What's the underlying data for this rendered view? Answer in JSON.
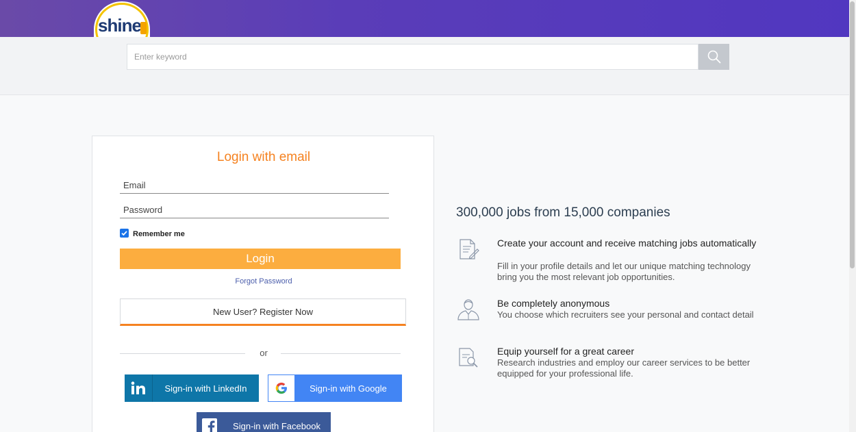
{
  "header": {
    "logo_text": "shine",
    "brand_color": "#5137c0",
    "logo_accent": "#f4c300"
  },
  "search": {
    "placeholder": "Enter keyword",
    "value": "",
    "button_icon": "search-icon"
  },
  "login": {
    "title": "Login with email",
    "email_placeholder": "Email",
    "password_placeholder": "Password",
    "remember_label": "Remember me",
    "remember_checked": true,
    "login_button": "Login",
    "forgot_password": "Forgot Password",
    "register": "New User? Register Now",
    "or_text": "or",
    "accent_color": "#f58220",
    "button_color": "#fcad3f"
  },
  "social": {
    "linkedin": "Sign-in with LinkedIn",
    "google": "Sign-in with Google",
    "facebook": "Sign-in with Facebook"
  },
  "promo": {
    "heading": "300,000 jobs from 15,000 companies",
    "features": [
      {
        "icon": "document-edit-icon",
        "title": "Create your account and receive matching jobs automatically",
        "description": "Fill in your profile details and let our unique matching technology bring you the most relevant job opportunities."
      },
      {
        "icon": "person-icon",
        "title": "Be completely anonymous",
        "description": "You choose which recruiters see your personal and contact detail"
      },
      {
        "icon": "document-search-icon",
        "title": "Equip yourself for a great career",
        "description": "Research industries and employ our career services to be better equipped for your professional life."
      }
    ]
  }
}
